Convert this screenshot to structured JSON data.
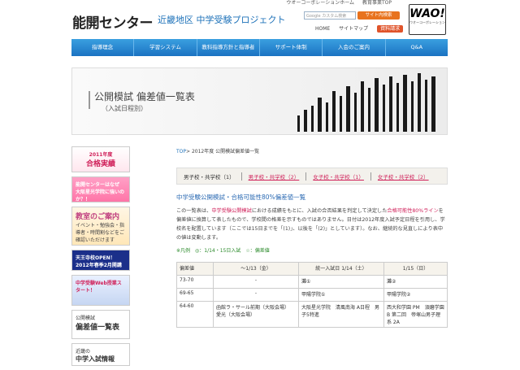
{
  "header": {
    "top_links": [
      "ウオーコーポレーションホーム",
      "教育事業TOP"
    ],
    "logo": "能開センター",
    "subtitle": "近畿地区 中学受験プロジェクト",
    "search_placeholder": "Google カスタム検索",
    "search_button": "サイト内検索",
    "links": [
      "HOME",
      "サイトマップ"
    ],
    "small_button": "資料請求",
    "wao_logo": "WAO!",
    "wao_sub": "ウオーコーポレーション"
  },
  "nav": [
    "指導理念",
    "学習システム",
    "教科指導方針と指導者",
    "サポート体制",
    "入会のご案内",
    "Q&A"
  ],
  "banner": {
    "title": "公開模試 偏差値一覧表",
    "sub": "（入試日程別）"
  },
  "sidebar": {
    "cards": [
      {
        "line1": "2011年度",
        "line2": "合格実績"
      },
      {
        "line1": "能開センターはなぜ",
        "line2": "大阪星光学院に強いのか？！"
      },
      {
        "line1": "教室のご案内",
        "line2": "イベント・勉強会・指導者・時間割などをご確認いただけます"
      },
      {
        "line1": "天王寺校OPEN！",
        "line2": "2012年春季2月開講"
      },
      {
        "line1": "中学受験Web授業スタート！",
        "line2": ""
      },
      {
        "line1": "公開模試",
        "line2": "偏差値一覧表"
      },
      {
        "line1": "近畿の",
        "line2": "中学入試情報"
      }
    ]
  },
  "main": {
    "breadcrumb_top": "TOP",
    "breadcrumb_rest": "> 2012年度 公開模試偏差値一覧",
    "tabs": [
      "男子校・共学校（1）",
      "男子校・共学校（2）",
      "女子校・共学校（1）",
      "女子校・共学校（2）"
    ],
    "heading": "中学受験公開模試・合格可能性80%偏差値一覧",
    "para_1": "この一覧表は、",
    "para_red1": "中学受験公開模試",
    "para_2": "における成績をもとに、入試の合否結果を判定して決定した",
    "para_red2": "合格可能性80%ライン",
    "para_3": "を偏差値に換算して表したもので、学校間の格差を示すものではありません。日付は2012年度入試予定日程を引用し、学校名を配置しています（ここでは15日までを「(1)」、以後を「(2)」としています）。なお、継続的な見直しにより表中の値は変動します。",
    "legend": "※凡例　◎：1/14・15日入試　☆：偏差値",
    "table": {
      "headers": [
        "偏差値",
        "〜1/13（金）",
        "統一入試日 1/14（土）",
        "1/15（日）"
      ],
      "rows": [
        [
          "73-70",
          "-",
          "灘①",
          "灘②"
        ],
        [
          "69-65",
          "-",
          "甲陽学院①",
          "甲陽学院②"
        ],
        [
          "64-60",
          "函館ラ・サール前期（大阪会場）　愛光（大阪会場）",
          "大阪星光学院　清風南海 A日程　男子5特進",
          "西大和学園 PM　須磨学園 B 第二回　帝塚山男子理系 2A"
        ]
      ]
    }
  }
}
